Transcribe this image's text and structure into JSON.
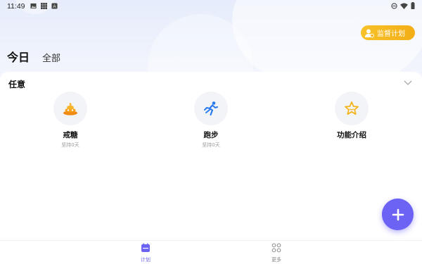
{
  "status_bar": {
    "time": "11:49"
  },
  "header": {
    "supervise_label": "监督计划",
    "tabs": [
      {
        "label": "今日",
        "active": true
      },
      {
        "label": "全部",
        "active": false
      }
    ]
  },
  "section": {
    "title": "任意",
    "items": [
      {
        "name": "戒糖",
        "sub": "坚持0天",
        "icon": "poop-emoji-icon"
      },
      {
        "name": "跑步",
        "sub": "坚持0天",
        "icon": "running-icon"
      },
      {
        "name": "功能介绍",
        "sub": "",
        "icon": "star-icon"
      }
    ]
  },
  "bottom_nav": [
    {
      "label": "计划",
      "active": true,
      "icon": "calendar-icon"
    },
    {
      "label": "更多",
      "active": false,
      "icon": "grid-icon"
    }
  ],
  "colors": {
    "accent": "#6c63f4",
    "supervise": "#f5b41d"
  }
}
